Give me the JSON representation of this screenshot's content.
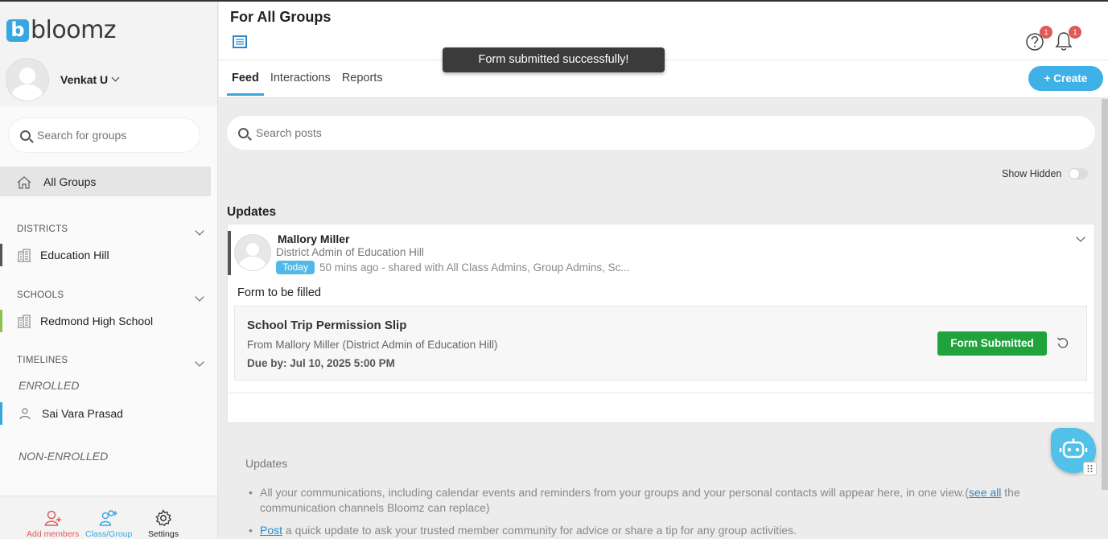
{
  "sidebar": {
    "logo_text": "bloomz",
    "logo_letter": "b",
    "user_name": "Venkat U",
    "group_search_placeholder": "Search for groups",
    "all_groups_label": "All Groups",
    "sections": {
      "districts": "DISTRICTS",
      "schools": "SCHOOLS",
      "timelines": "TIMELINES"
    },
    "district_item": "Education Hill",
    "school_item": "Redmond High School",
    "enrolled_label": "ENROLLED",
    "enrolled_item": "Sai Vara Prasad",
    "non_enrolled_label": "NON-ENROLLED",
    "bottom": {
      "add_members": "Add members",
      "class_group": "Class/Group",
      "settings": "Settings"
    }
  },
  "header": {
    "title": "For All Groups",
    "tabs": [
      {
        "label": "Feed"
      },
      {
        "label": "Interactions"
      },
      {
        "label": "Reports"
      }
    ],
    "create_label": "+ Create",
    "help_badge": "1",
    "notif_badge": "1"
  },
  "toast": {
    "message": "Form submitted successfully!"
  },
  "feed": {
    "search_placeholder": "Search posts",
    "show_hidden_label": "Show Hidden",
    "updates_heading": "Updates",
    "post": {
      "author": "Mallory Miller",
      "role": "District Admin of Education Hill",
      "today_label": "Today",
      "meta": "50 mins ago - shared with All Class Admins, Group Admins, Sc...",
      "text": "Form to be filled",
      "form": {
        "title": "School Trip Permission Slip",
        "from": "From Mallory Miller (District Admin of Education Hill)",
        "due": "Due by: Jul 10, 2025 5:00 PM",
        "status_label": "Form Submitted"
      }
    },
    "info": {
      "title": "Updates",
      "item1_text": "All your communications, including calendar events and reminders from your groups and your personal contacts will appear here, in one view.(",
      "item1_link": "see all",
      "item1_tail": " the communication channels Bloomz can replace)",
      "item2_link": "Post",
      "item2_tail": " a quick update to ask your trusted member community for advice or share a tip for any group activities."
    }
  },
  "colors": {
    "accent": "#3aa6e0",
    "success": "#1fa33a",
    "badge": "#e05a5a",
    "school_bar": "#8bc34a",
    "timeline_bar": "#3aa6e0"
  }
}
